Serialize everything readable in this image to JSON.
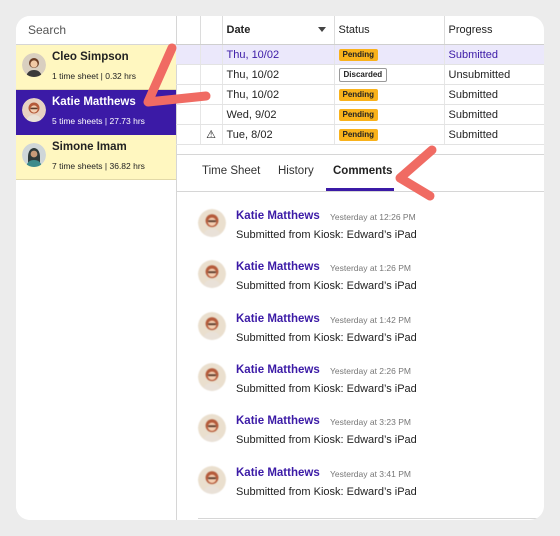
{
  "sidebar": {
    "search_placeholder": "Search",
    "people": [
      {
        "name": "Cleo Simpson",
        "meta": "1 time sheet | 0.32 hrs",
        "selected": false
      },
      {
        "name": "Katie Matthews",
        "meta": "5 time sheets | 27.73 hrs",
        "selected": true
      },
      {
        "name": "Simone Imam",
        "meta": "7 time sheets | 36.82 hrs",
        "selected": false
      }
    ]
  },
  "grid": {
    "headers": {
      "date": "Date",
      "status": "Status",
      "progress": "Progress"
    },
    "rows": [
      {
        "date": "Thu, 10/02",
        "status": "Pending",
        "progress": "Submitted",
        "warning": false
      },
      {
        "date": "Thu, 10/02",
        "status": "Discarded",
        "progress": "Unsubmitted",
        "warning": false
      },
      {
        "date": "Thu, 10/02",
        "status": "Pending",
        "progress": "Submitted",
        "warning": false
      },
      {
        "date": "Wed, 9/02",
        "status": "Pending",
        "progress": "Submitted",
        "warning": false
      },
      {
        "date": "Tue, 8/02",
        "status": "Pending",
        "progress": "Submitted",
        "warning": true
      }
    ]
  },
  "tabs": [
    "Time Sheet",
    "History",
    "Comments"
  ],
  "active_tab": "Comments",
  "comments": [
    {
      "author": "Katie Matthews",
      "time": "Yesterday at 12:26 PM",
      "text": "Submitted from Kiosk: Edward’s iPad"
    },
    {
      "author": "Katie Matthews",
      "time": "Yesterday at 1:26 PM",
      "text": "Submitted from Kiosk: Edward’s iPad"
    },
    {
      "author": "Katie Matthews",
      "time": "Yesterday at 1:42 PM",
      "text": "Submitted from Kiosk: Edward’s iPad"
    },
    {
      "author": "Katie Matthews",
      "time": "Yesterday at 2:26 PM",
      "text": "Submitted from Kiosk: Edward’s iPad"
    },
    {
      "author": "Katie Matthews",
      "time": "Yesterday at 3:23 PM",
      "text": "Submitted from Kiosk: Edward’s iPad"
    },
    {
      "author": "Katie Matthews",
      "time": "Yesterday at 3:41 PM",
      "text": "Submitted from Kiosk: Edward’s iPad"
    }
  ],
  "colors": {
    "accent": "#3b1aa6",
    "sidebar_highlight": "#fff7c0",
    "badge_pending": "#f9b21b",
    "annotation": "#f06b63"
  },
  "icons": {
    "sort": "chevron-down-icon",
    "warning": "warning-icon",
    "avatar": "user-avatar-icon"
  }
}
